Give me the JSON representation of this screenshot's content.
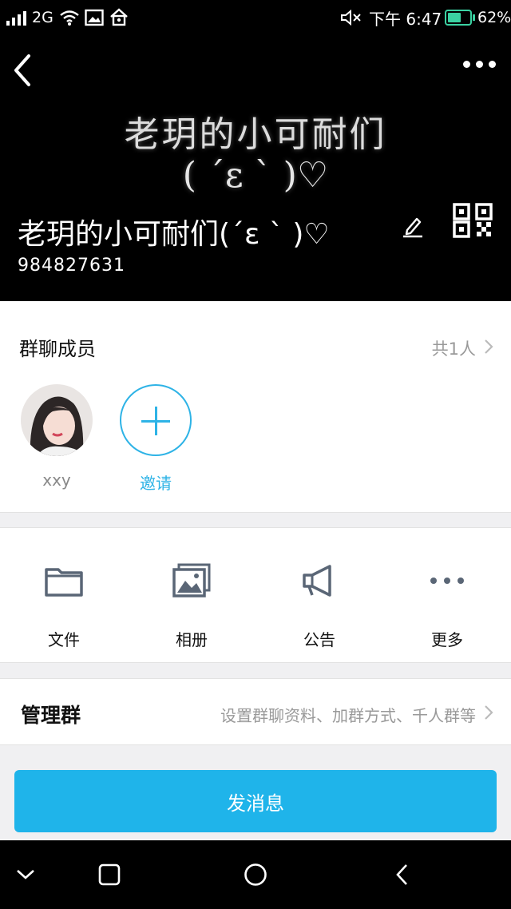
{
  "status_bar": {
    "network": "2G",
    "time": "下午 6:47",
    "battery": "62%",
    "battery_level": 0.62
  },
  "header": {
    "banner_line1": "老玥的小可耐们",
    "banner_line2": "( ˊε ˋ )♡",
    "group_name": "老玥的小可耐们(ˊε ˋ )♡",
    "group_id": "984827631"
  },
  "members": {
    "title": "群聊成员",
    "count": "共1人",
    "items": [
      {
        "name": "xxy"
      }
    ],
    "invite_label": "邀请"
  },
  "tools": [
    {
      "label": "文件",
      "icon": "folder-icon"
    },
    {
      "label": "相册",
      "icon": "album-icon"
    },
    {
      "label": "公告",
      "icon": "megaphone-icon"
    },
    {
      "label": "更多",
      "icon": "more-icon"
    }
  ],
  "manage": {
    "title": "管理群",
    "description": "设置群聊资料、加群方式、千人群等"
  },
  "actions": {
    "send_label": "发消息"
  },
  "colors": {
    "accent": "#1fb4ea",
    "header_bg": "#000000",
    "battery": "#3bd2a2"
  }
}
